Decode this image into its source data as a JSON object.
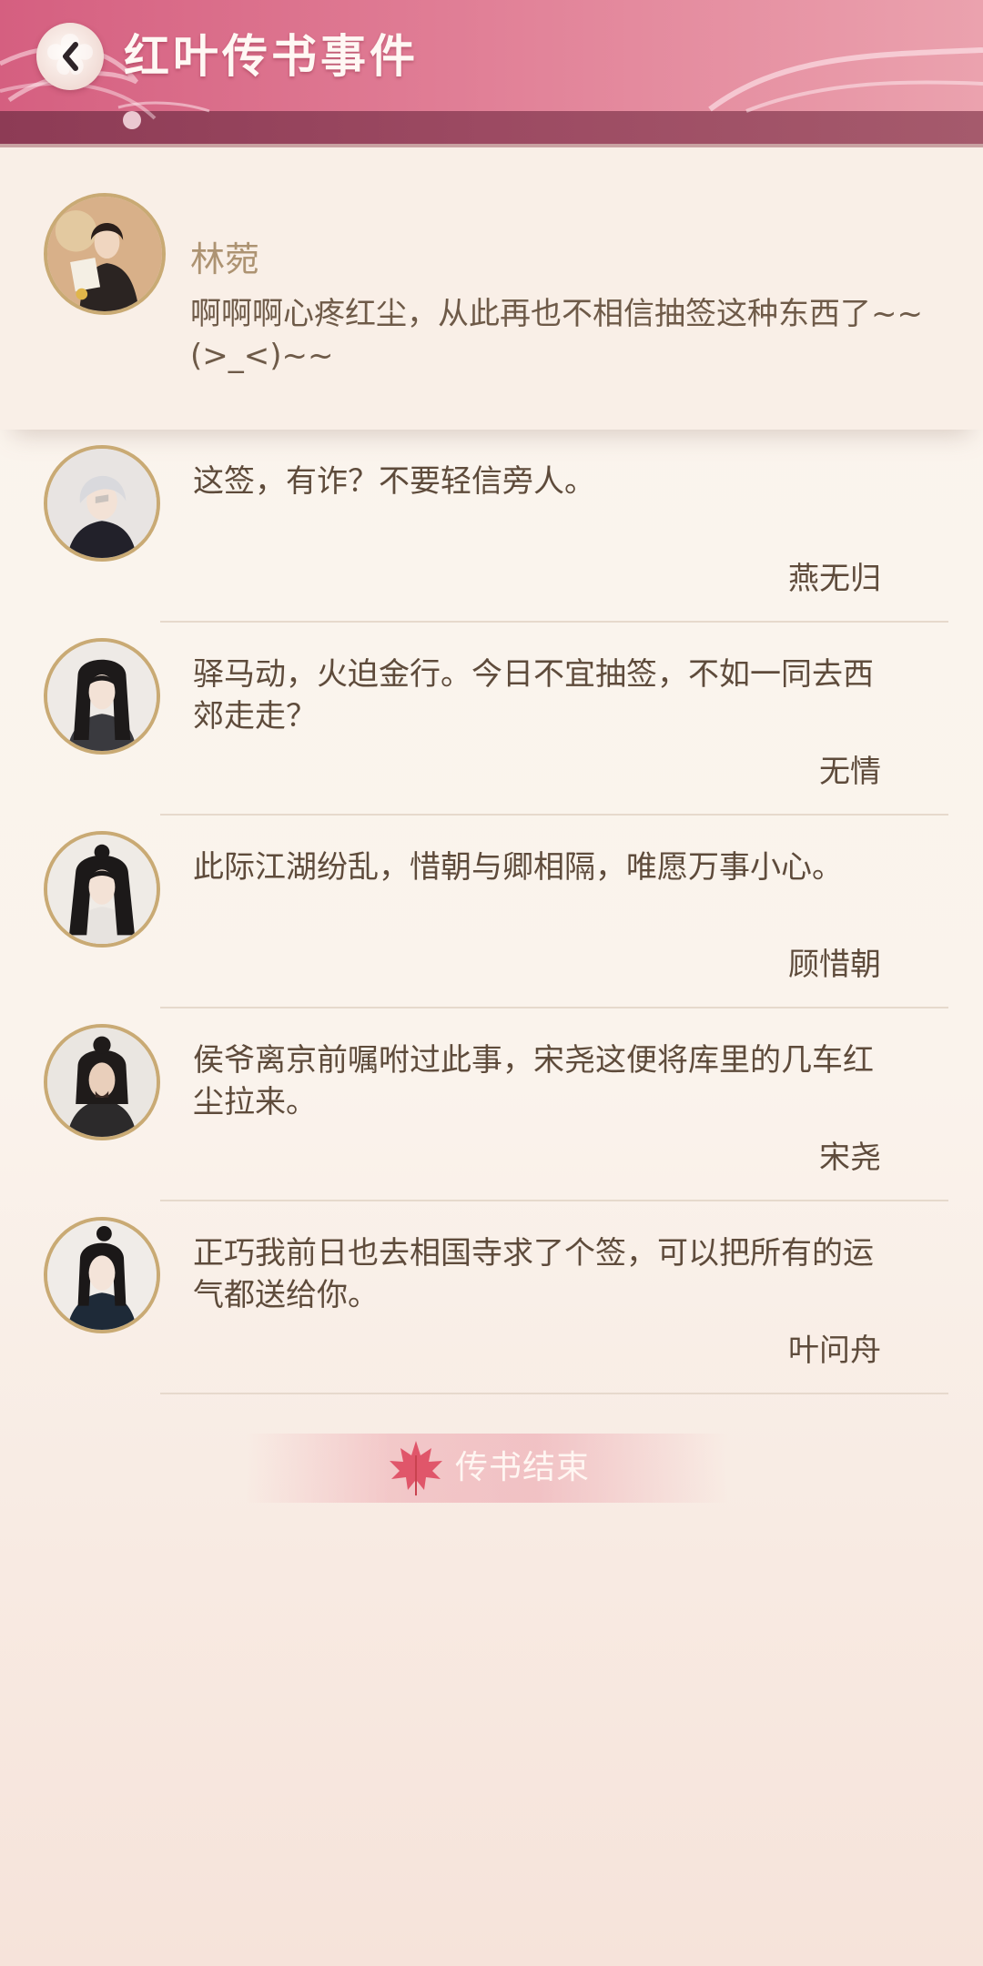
{
  "header": {
    "title": "红叶传书事件",
    "back_icon": "back-arrow-icon"
  },
  "post": {
    "name": "林菀",
    "text": "啊啊啊心疼红尘，从此再也不相信抽签这种东西了~~(>_<)~~"
  },
  "replies": [
    {
      "text": "这签，有诈？不要轻信旁人。",
      "author": "燕无归"
    },
    {
      "text": "驿马动，火迫金行。今日不宜抽签，不如一同去西郊走走？",
      "author": "无情"
    },
    {
      "text": "此际江湖纷乱，惜朝与卿相隔，唯愿万事小心。",
      "author": "顾惜朝"
    },
    {
      "text": "侯爷离京前嘱咐过此事，宋尧这便将库里的几车红尘拉来。",
      "author": "宋尧"
    },
    {
      "text": "正巧我前日也去相国寺求了个签，可以把所有的运气都送给你。",
      "author": "叶问舟"
    }
  ],
  "end_banner": {
    "label": "传书结束",
    "icon": "maple-leaf-icon"
  },
  "colors": {
    "header_pink": "#e07d95",
    "header_band": "#8d3b55",
    "avatar_border": "#c9aa74",
    "text_brown": "#5e4b3b"
  }
}
